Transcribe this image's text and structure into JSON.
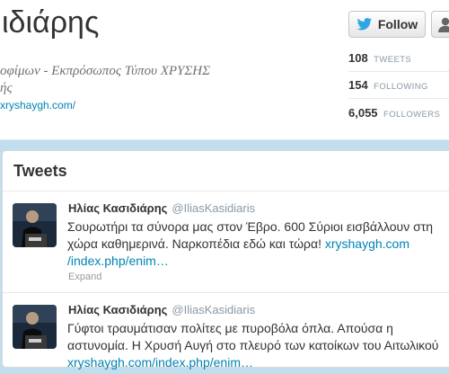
{
  "profile": {
    "name": "ιδιάρης",
    "bio_line1": "οφίμων - Εκπρόσωπος Τύπου ΧΡΥΣΗΣ",
    "bio_line2": "ής",
    "website": "xryshaygh.com/"
  },
  "actions": {
    "follow_label": "Follow",
    "follow_icon": "twitter-bird-icon",
    "user_icon": "user-icon"
  },
  "stats": [
    {
      "value": "108",
      "label": "TWEETS"
    },
    {
      "value": "154",
      "label": "FOLLOWING"
    },
    {
      "value": "6,055",
      "label": "FOLLOWERS"
    }
  ],
  "tweets_panel": {
    "title": "Tweets",
    "tweets": [
      {
        "name": "Ηλίας Κασιδιάρης",
        "handle": "@IliasKasidiaris",
        "line1": "Σουρωτήρι τα σύνορα μας στον Έβρο. 600 Σύριοι εισβάλλουν στη",
        "line2_text": "χώρα καθημερινά. Ναρκοπέδια εδώ και τώρα!",
        "line2_link": "xryshaygh.com",
        "line3_link": "/index.php/enim…",
        "expand": "Expand"
      },
      {
        "name": "Ηλίας Κασιδιάρης",
        "handle": "@IliasKasidiaris",
        "line1": "Γύφτοι τραυμάτισαν πολίτες με πυροβόλα όπλα. Απούσα η",
        "line2_text": "αστυνομία. Η Χρυσή Αυγή στο πλευρό των κατοίκων του Αιτωλικού",
        "line3_link": "xryshaygh.com/index.php/enim…"
      }
    ]
  },
  "colors": {
    "background": "#c0deed",
    "link": "#0084b4",
    "twitter_blue": "#2fa5e6",
    "muted": "#8899a6"
  }
}
